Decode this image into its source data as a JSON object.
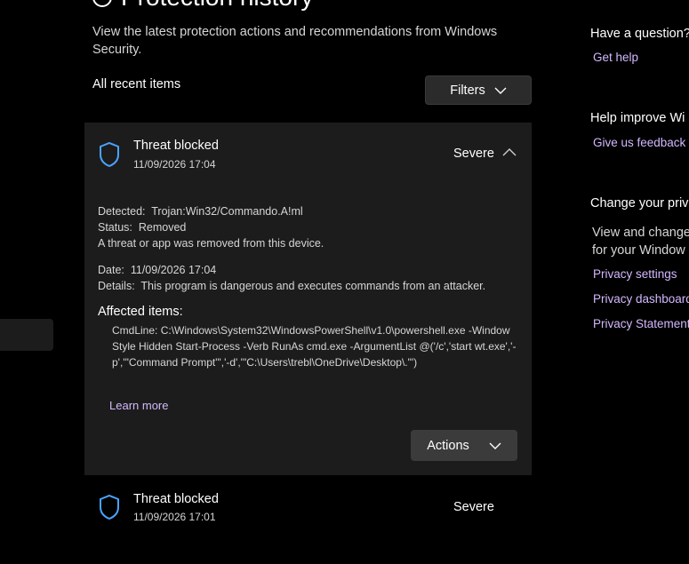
{
  "header": {
    "title": "Protection history",
    "description": "View the latest protection actions and recommendations from Windows Security.",
    "all_recent_label": "All recent items",
    "filters_label": "Filters"
  },
  "threats": [
    {
      "title": "Threat blocked",
      "date": "11/09/2026 17:04",
      "severity": "Severe",
      "expanded": true,
      "detected_label": "Detected:",
      "detected_value": "Trojan:Win32/Commando.A!ml",
      "status_label": "Status:",
      "status_value": "Removed",
      "status_message": "A threat or app was removed from this device.",
      "date_label": "Date:",
      "date_value": "11/09/2026 17:04",
      "details_label": "Details:",
      "details_value": "This program is dangerous and executes commands from an attacker.",
      "affected_title": "Affected items:",
      "cmdline": "CmdLine: C:\\Windows\\System32\\WindowsPowerShell\\v1.0\\powershell.exe -WindowStyle Hidden Start-Process -Verb RunAs cmd.exe -ArgumentList @('/c','start wt.exe','-p','\"Command Prompt\"','-d','\"C:\\Users\\trebl\\OneDrive\\Desktop\\.\"')",
      "learn_more": "Learn more",
      "actions_label": "Actions"
    },
    {
      "title": "Threat blocked",
      "date": "11/09/2026 17:01",
      "severity": "Severe",
      "expanded": false
    }
  ],
  "sidebar": {
    "question_heading": "Have a question?",
    "get_help": "Get help",
    "improve_heading": "Help improve Wi",
    "feedback": "Give us feedback",
    "privacy_heading": "Change your priv",
    "privacy_text_1": "View and change",
    "privacy_text_2": "for your Window",
    "privacy_settings": "Privacy settings",
    "privacy_dashboard": "Privacy dashboard",
    "privacy_statement": "Privacy Statement"
  },
  "colors": {
    "background": "#000000",
    "card": "#1c1c1c",
    "accent_link": "#d3b8ff",
    "shield": "#4aa3ff"
  },
  "icons": {
    "shield": "shield-icon",
    "chevron_down": "chevron-down-icon",
    "chevron_up": "chevron-up-icon"
  }
}
